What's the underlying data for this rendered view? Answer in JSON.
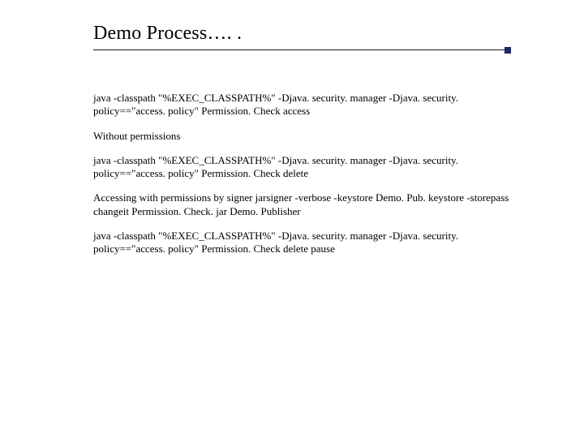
{
  "title": "Demo Process…. .",
  "paragraphs": [
    "java -classpath \"%EXEC_CLASSPATH%\" -Djava. security. manager -Djava. security. policy==\"access. policy\" Permission. Check access",
    "Without permissions",
    "java -classpath \"%EXEC_CLASSPATH%\" -Djava. security. manager -Djava. security. policy==\"access. policy\" Permission. Check delete",
    "Accessing with permissions by signer\njarsigner -verbose -keystore Demo. Pub. keystore -storepass changeit Permission. Check. jar Demo. Publisher",
    "java -classpath \"%EXEC_CLASSPATH%\" -Djava. security. manager -Djava. security. policy==\"access. policy\" Permission. Check delete pause"
  ]
}
